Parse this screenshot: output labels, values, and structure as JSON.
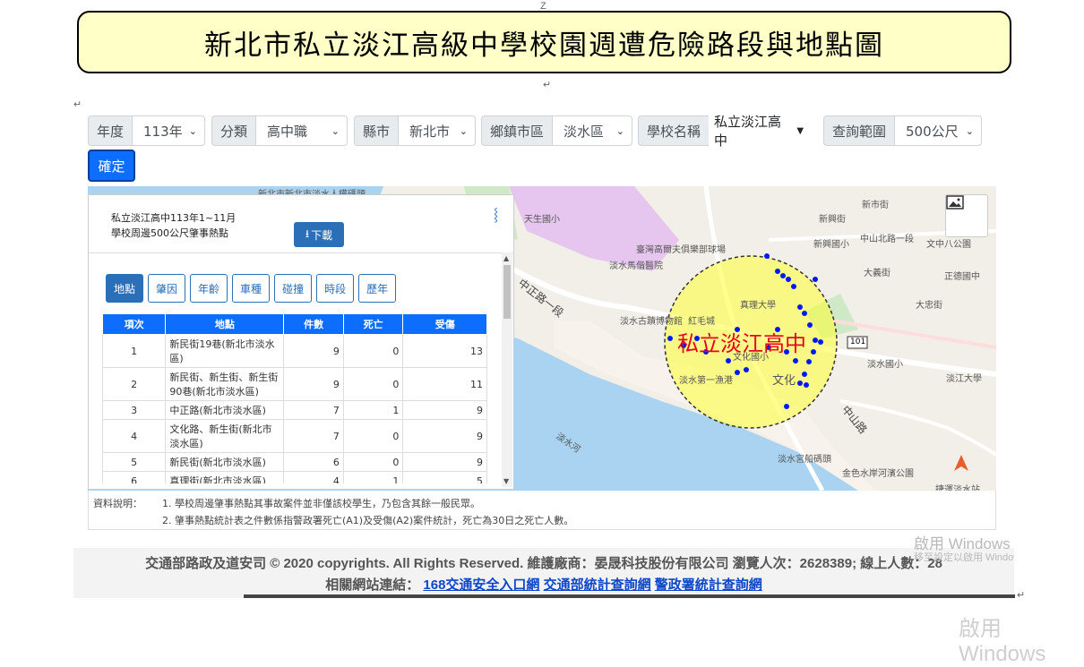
{
  "title": "新北市私立淡江高級中學校園週遭危險路段與地點圖",
  "doc_marks": {
    "top": "Z",
    "para": "↵"
  },
  "filters": [
    {
      "label": "年度",
      "value": "113年"
    },
    {
      "label": "分類",
      "value": "高中職"
    },
    {
      "label": "縣市",
      "value": "新北市"
    },
    {
      "label": "鄉鎮市區",
      "value": "淡水區"
    },
    {
      "label": "學校名稱",
      "value": "私立淡江高中"
    },
    {
      "label": "查詢範圍",
      "value": "500公尺"
    }
  ],
  "confirm_label": "確定",
  "panel": {
    "line1": "私立淡江高中113年1~11月",
    "line2": "學校周邊500公尺肇事熱點",
    "download_label": "下載",
    "tabs": [
      "地點",
      "肇因",
      "年齡",
      "車種",
      "碰撞",
      "時段",
      "歷年"
    ],
    "active_tab": "地點",
    "table": {
      "headers": [
        "項次",
        "地點",
        "件數",
        "死亡",
        "受傷"
      ],
      "rows": [
        [
          "1",
          "新民街19巷(新北市淡水區)",
          "9",
          "0",
          "13"
        ],
        [
          "2",
          "新民街、新生街、新生街90巷(新北市淡水區)",
          "9",
          "0",
          "11"
        ],
        [
          "3",
          "中正路(新北市淡水區)",
          "7",
          "1",
          "9"
        ],
        [
          "4",
          "文化路、新生街(新北市淡水區)",
          "7",
          "0",
          "9"
        ],
        [
          "5",
          "新民街(新北市淡水區)",
          "6",
          "0",
          "9"
        ],
        [
          "6",
          "真理街(新北市淡水區)",
          "4",
          "1",
          "5"
        ]
      ]
    }
  },
  "map": {
    "school_label": "私立淡江高中",
    "labels": {
      "tianshengguoxiao": "天生國小",
      "xinxingjie": "新興街",
      "xinxingguoxiao": "新興國小",
      "zhongshanbeilu": "中山北路一段",
      "wenzhongba": "文中八公園",
      "xinshijie": "新市街",
      "dayijie": "大義街",
      "zhengde": "正德國中",
      "dazhongjie": "大忠街",
      "zhongzhenglu": "中正路一段",
      "zhenli": "真理大學",
      "hongmaocheng": "紅毛城",
      "museum": "淡水古蹟博物館",
      "wenhuaguoxiao": "文化國小",
      "wenhua": "文化",
      "fishport": "淡水第一漁港",
      "tamsuiguoxiao": "淡水國小",
      "tamkang": "淡江大學",
      "route101": "101",
      "river": "淡水河",
      "zhongshanlu": "中山路",
      "ferry": "淡水宮船碼頭",
      "jinse": "金色水岸河濱公園",
      "tamsuiren": "臺灣高爾夫俱樂部球場",
      "hosp": "淡水馬偕醫院",
      "top_partial": "新北市新北市淡水人權碼頭",
      "bottom_partial": "捷運淡水站"
    },
    "colors": {
      "zone": "#ffff33",
      "points": "#0018f5",
      "school_text": "#e8001c",
      "water": "#a9d3f0"
    }
  },
  "notes": {
    "heading": "資料說明：",
    "items": [
      "1. 學校周邊肇事熱點其事故案件並非僅該校學生，乃包含其餘一般民眾。",
      "2. 肇事熱點統計表之件數係指警政署死亡(A1)及受傷(A2)案件統計，死亡為30日之死亡人數。"
    ]
  },
  "footer": {
    "line1": "交通部路政及道安司 © 2020 copyrights. All Rights Reserved. 維護廠商：晏晟科技股份有限公司 瀏覽人次：2628389; 線上人數：28",
    "links_label": "相關網站連結：",
    "links": [
      "168交通安全入口網",
      "交通部統計查詢網",
      "警政署統計查詢網"
    ]
  },
  "watermark": {
    "text": "啟用 Windows",
    "sub": "移至設定以啟用 Windows",
    "bottom": "啟用 Windows"
  }
}
